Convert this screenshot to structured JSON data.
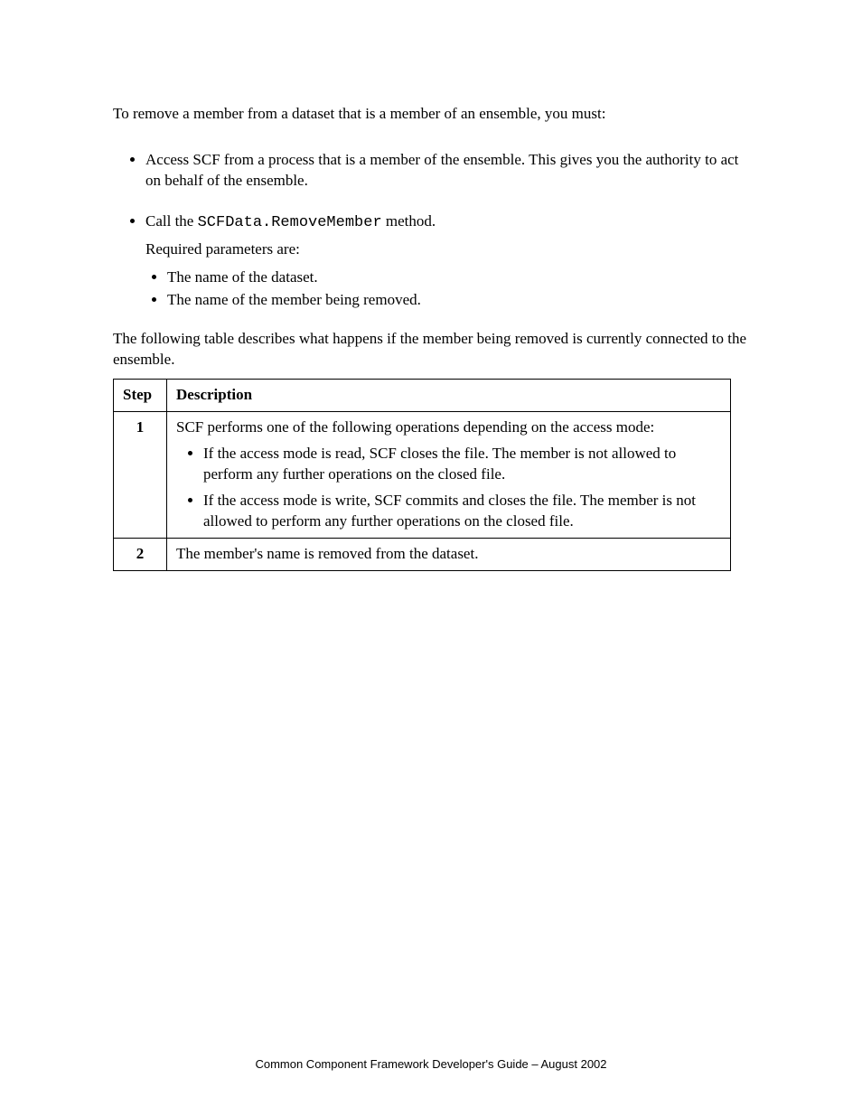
{
  "intro": "To remove a member from a dataset that is a member of an ensemble, you must:",
  "bullets": [
    "Access SCF from a process that is a member of the ensemble. This gives you the authority to act on behalf of the ensemble.",
    {
      "lead": "Call the ",
      "code": "SCFData.RemoveMember",
      "tail": " method.",
      "required_intro": "Required parameters are:",
      "required": [
        "The name of the dataset.",
        "The name of the member being removed."
      ]
    }
  ],
  "table_intro": "The following table describes what happens if the member being removed is currently connected to the ensemble.",
  "table": {
    "headers": [
      "Step",
      "Description"
    ],
    "rows": [
      {
        "step": "1",
        "intro": "SCF performs one of the following operations depending on the access mode:",
        "items": [
          "If the access mode is read, SCF closes the file. The member is not allowed to perform any further operations on the closed file.",
          "If the access mode is write, SCF commits and closes the file. The member is not allowed to perform any further operations on the closed file."
        ]
      },
      {
        "step": "2",
        "plain": "The member's name is removed from the dataset."
      }
    ]
  },
  "footer": "Common Component Framework Developer's Guide – August 2002"
}
